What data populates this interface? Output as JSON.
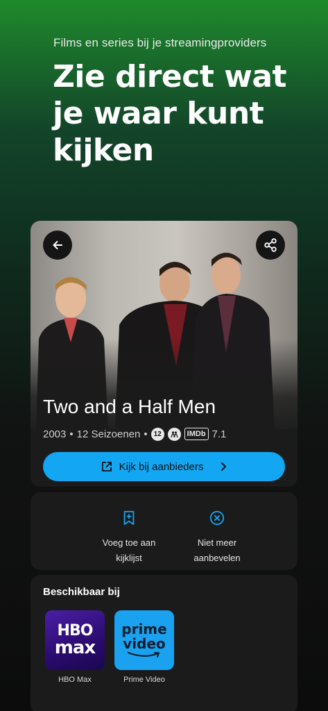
{
  "hero": {
    "subtitle": "Films en series bij je streamingproviders",
    "title": "Zie direct wat je waar kunt kijken"
  },
  "detail": {
    "show_title": "Two and a Half Men",
    "year": "2003",
    "seasons": "12 Seizoenen",
    "age_rating": "12",
    "imdb_label": "IMDb",
    "imdb_score": "7.1",
    "cta_label": "Kijk bij aanbieders",
    "icons": {
      "back": "arrow-left-icon",
      "share": "share-icon",
      "external": "external-link-icon",
      "chevron": "chevron-right-icon"
    }
  },
  "actions": {
    "watchlist_line1": "Voeg toe aan",
    "watchlist_line2": "kijklijst",
    "dismiss_line1": "Niet meer",
    "dismiss_line2": "aanbevelen"
  },
  "availability": {
    "title": "Beschikbaar bij",
    "providers": [
      {
        "name": "HBO Max",
        "logo_top": "HBO",
        "logo_bottom": "max"
      },
      {
        "name": "Prime Video",
        "logo_top": "prime",
        "logo_bottom": "video"
      }
    ]
  },
  "colors": {
    "accent": "#12a6f3",
    "card": "#1b1b1b",
    "hbo": "#3a1490",
    "prime": "#1aa1f0"
  }
}
